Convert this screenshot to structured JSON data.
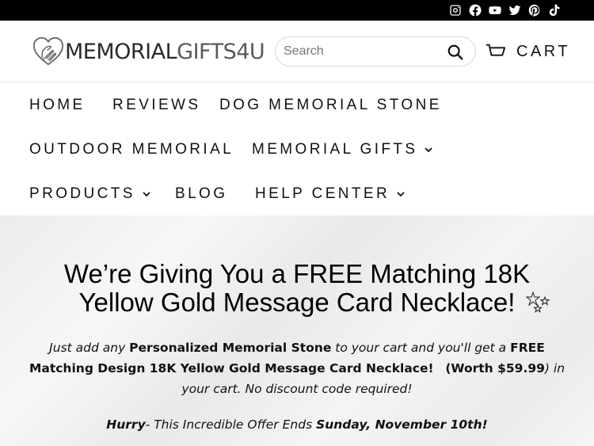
{
  "social": {
    "icons": [
      "instagram-icon",
      "facebook-icon",
      "youtube-icon",
      "twitter-icon",
      "pinterest-icon",
      "tiktok-icon"
    ]
  },
  "header": {
    "logo_part1": "MEMORIAL",
    "logo_part2": "GIFTS4U",
    "search_placeholder": "Search",
    "cart_label": "CART"
  },
  "nav": {
    "home": "HOME",
    "reviews": "REVIEWS",
    "dog_memorial_stone": "DOG MEMORIAL STONE",
    "outdoor_memorial": "OUTDOOR MEMORIAL",
    "memorial_gifts": "MEMORIAL GIFTS",
    "products": "PRODUCTS",
    "blog": "BLOG",
    "help_center": "HELP CENTER"
  },
  "hero": {
    "title_line1": "We’re Giving You a FREE Matching 18K",
    "title_line2": "Yellow Gold Message Card Necklace!",
    "copy_1": "Just add any ",
    "copy_2": "Personalized Memorial Stone",
    "copy_3": " to your cart and you'll get a ",
    "copy_4": "FREE Matching Design 18K Yellow Gold Message Card Necklace!",
    "copy_5": "(Worth $59.99",
    "copy_6": ") in your cart. No discount code required!",
    "hurry_1": "Hurry",
    "hurry_2": "- This Incredible Offer Ends ",
    "hurry_3": "Sunday, November 10th!"
  },
  "colors": {
    "topbar": "#000000",
    "text": "#111111"
  }
}
